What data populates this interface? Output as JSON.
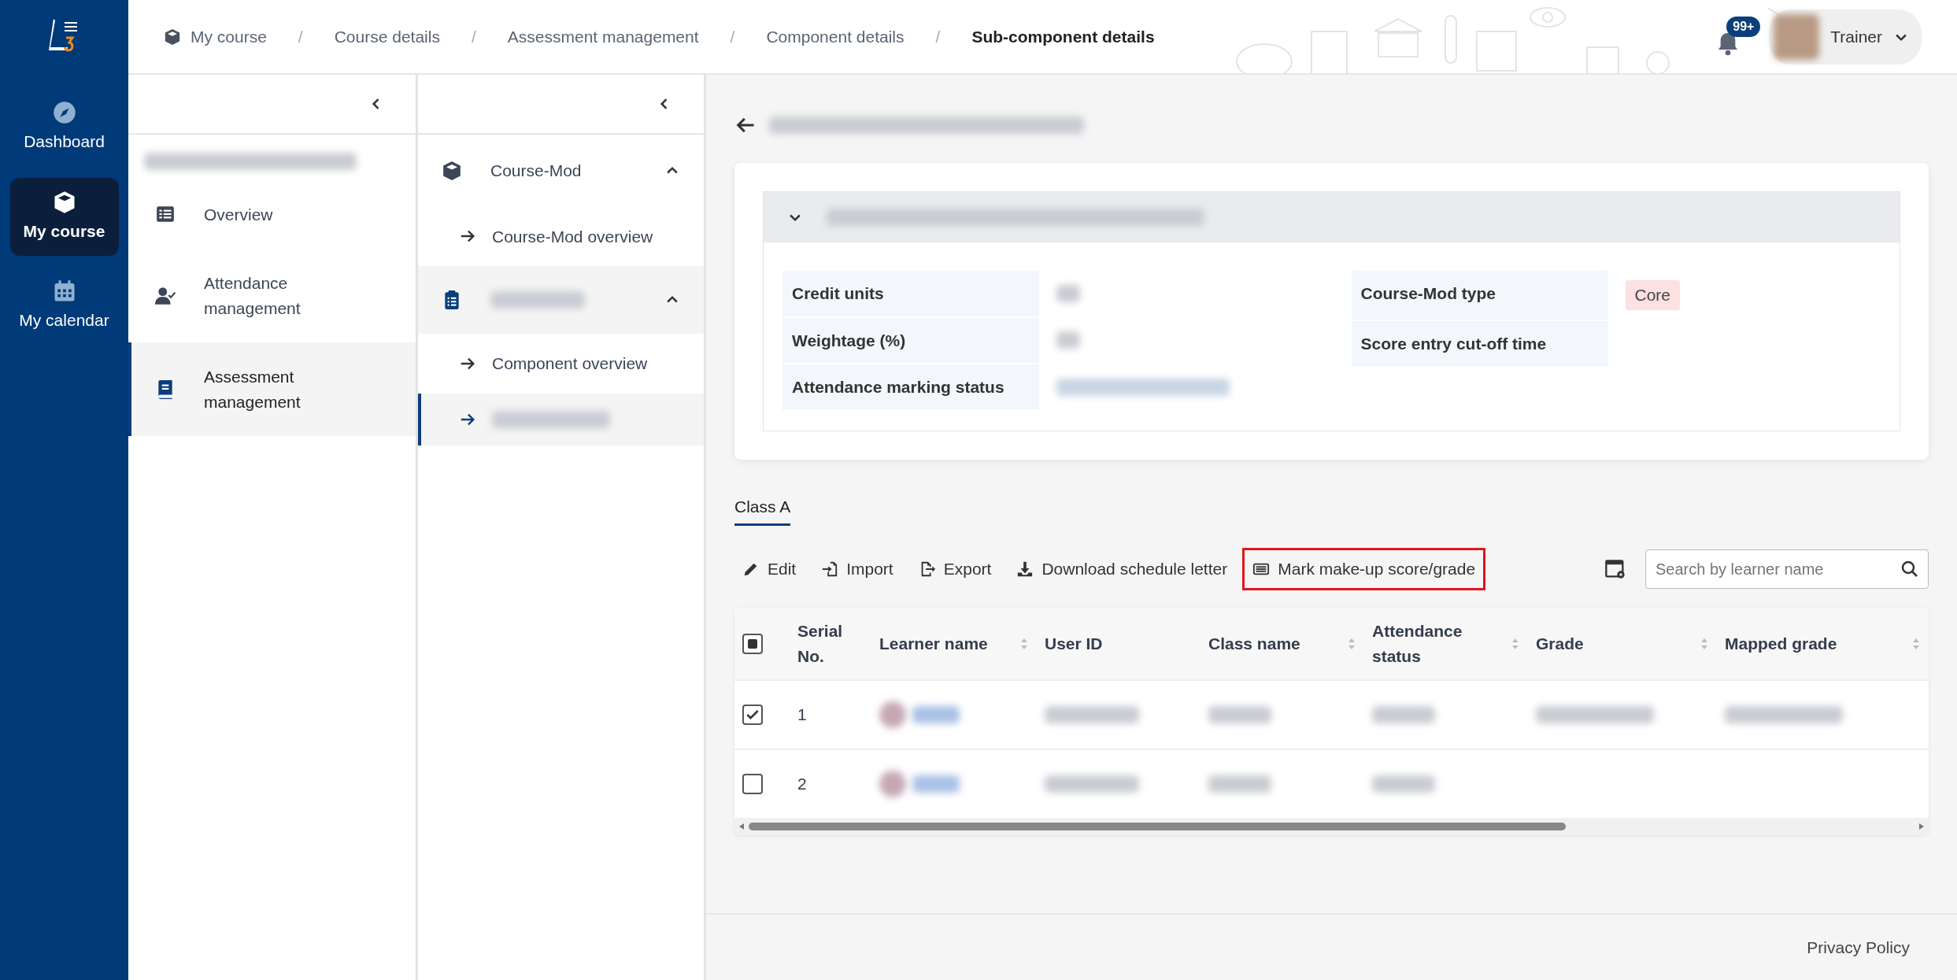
{
  "nav": [
    {
      "label": "Dashboard",
      "selected": false
    },
    {
      "label": "My course",
      "selected": true
    },
    {
      "label": "My calendar",
      "selected": false
    }
  ],
  "breadcrumbs": [
    {
      "label": "My course",
      "current": false
    },
    {
      "separator": "/",
      "label": "Course details",
      "current": false
    },
    {
      "separator": "/",
      "label": "Assessment management",
      "current": false
    },
    {
      "separator": "/",
      "label": "Component details",
      "current": false
    },
    {
      "separator": "/",
      "label": "Sub-component details",
      "current": true
    }
  ],
  "header": {
    "notification_count": "99+",
    "user": "Trainer"
  },
  "course_menu": {
    "title_blurred": true,
    "items": [
      {
        "label": "Overview",
        "selected": false
      },
      {
        "label": "Attendance management",
        "selected": false
      },
      {
        "label": "Assessment management",
        "selected": true
      }
    ]
  },
  "module_menu": {
    "groups": [
      {
        "label": "Course-Mod",
        "blurred": false,
        "expanded": true,
        "children": [
          {
            "label": "Course-Mod overview",
            "blurred": false,
            "selected": false
          }
        ]
      },
      {
        "blurred": true,
        "expanded": true,
        "children": [
          {
            "label": "Component overview",
            "blurred": false,
            "selected": false
          },
          {
            "blurred": true,
            "selected": true
          }
        ]
      }
    ]
  },
  "page": {
    "title_blurred": true,
    "details": {
      "expanded": true,
      "title_blurred": true,
      "left_fields": [
        {
          "label": "Credit units",
          "kind": "blurred"
        },
        {
          "label": "Weightage (%)",
          "kind": "blurred"
        },
        {
          "label": "Attendance marking status",
          "kind": "blurred-status"
        }
      ],
      "right_fields": [
        {
          "label": "Course-Mod type",
          "kind": "tag",
          "value": "Core"
        },
        {
          "label": "Score entry cut-off time",
          "kind": "empty"
        }
      ]
    },
    "tabs": [
      {
        "label": "Class A",
        "selected": true
      }
    ],
    "actions": [
      {
        "label": "Edit",
        "highlighted": false
      },
      {
        "label": "Import",
        "highlighted": false
      },
      {
        "label": "Export",
        "highlighted": false
      },
      {
        "label": "Download schedule letter",
        "highlighted": false
      },
      {
        "label": "Mark make-up score/grade",
        "highlighted": true
      }
    ],
    "search": {
      "placeholder": "Search by learner name"
    },
    "table": {
      "header_indeterminate": true,
      "columns": [
        {
          "label": "Serial No.",
          "sortable": false
        },
        {
          "label": "Learner name",
          "sortable": true
        },
        {
          "label": "User ID",
          "sortable": false
        },
        {
          "label": "Class name",
          "sortable": true
        },
        {
          "label": "Attendance status",
          "sortable": true
        },
        {
          "label": "Grade",
          "sortable": true
        },
        {
          "label": "Mapped grade",
          "sortable": true
        }
      ],
      "rows": [
        {
          "checked": true,
          "serial": "1",
          "cells": [
            {
              "blurred": true
            },
            {
              "blurred": true
            },
            {
              "blurred": true
            },
            {
              "blurred": true
            },
            {
              "blurred": true
            },
            {
              "blurred": true
            }
          ]
        },
        {
          "checked": false,
          "serial": "2",
          "cells": [
            {
              "blurred": true
            },
            {
              "blurred": true
            },
            {
              "blurred": true
            },
            {
              "blurred": true
            }
          ]
        }
      ]
    }
  },
  "footer": {
    "link": "Privacy Policy"
  }
}
